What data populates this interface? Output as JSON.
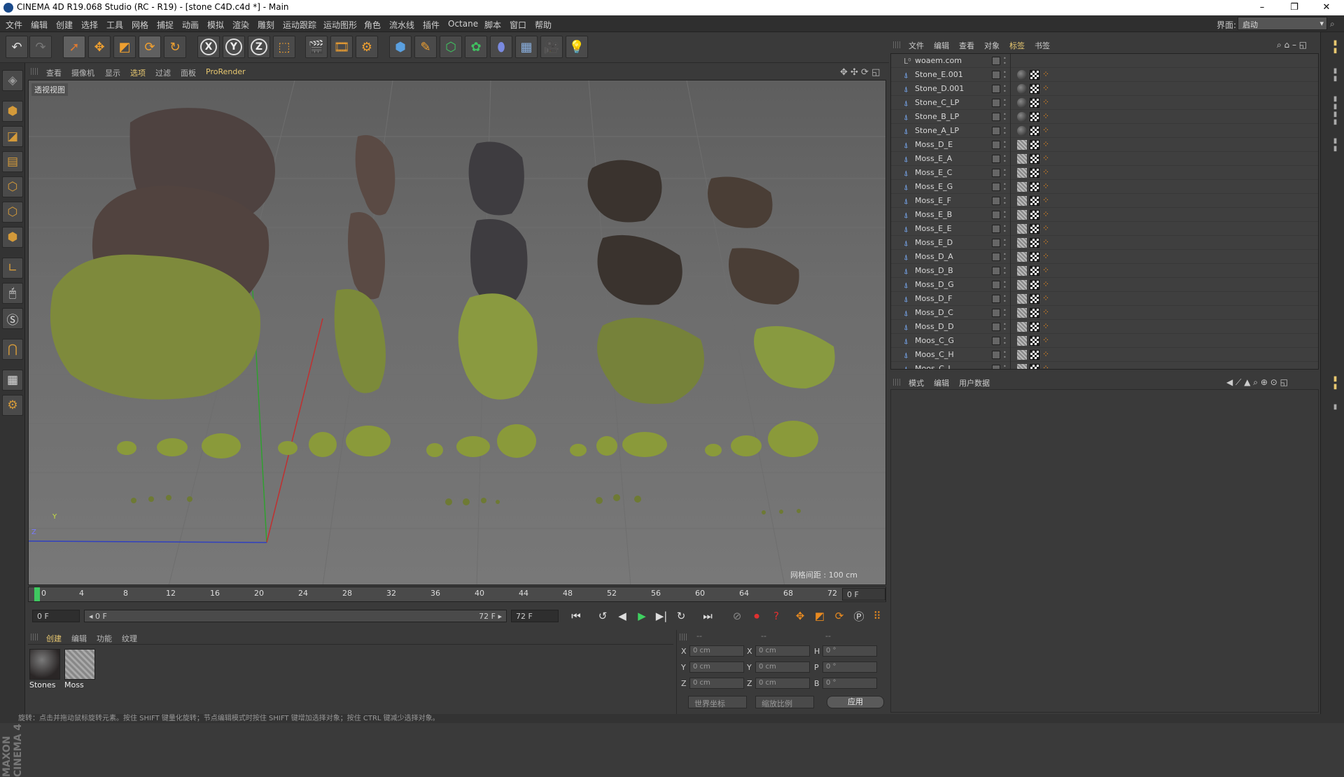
{
  "window": {
    "title": "CINEMA 4D R19.068 Studio (RC - R19) - [stone C4D.c4d *] - Main",
    "controls": [
      "–",
      "❐",
      "✕"
    ]
  },
  "menubar": {
    "items": [
      "文件",
      "编辑",
      "创建",
      "选择",
      "工具",
      "网格",
      "捕捉",
      "动画",
      "模拟",
      "渲染",
      "雕刻",
      "运动跟踪",
      "运动图形",
      "角色",
      "流水线",
      "插件",
      "Octane",
      "脚本",
      "窗口",
      "帮助"
    ],
    "layout_label": "界面:",
    "layout_value": "启动"
  },
  "viewport": {
    "menu": [
      "查看",
      "摄像机",
      "显示",
      "选项",
      "过滤",
      "面板"
    ],
    "prorender": "ProRender",
    "label": "透视视图",
    "grid_spacing": "网格间距 : 100 cm",
    "axis_x": "X",
    "axis_y": "Y",
    "axis_z": "Z"
  },
  "timeline": {
    "ticks": [
      "0",
      "4",
      "8",
      "12",
      "16",
      "20",
      "24",
      "28",
      "32",
      "36",
      "40",
      "44",
      "48",
      "52",
      "56",
      "60",
      "64",
      "68",
      "72"
    ],
    "current_frame": "0 F"
  },
  "transport": {
    "start": "0 F",
    "range_start": "◂ 0 F",
    "range_end": "72 F ▸",
    "end": "72 F"
  },
  "material_manager": {
    "menu": [
      "创建",
      "编辑",
      "功能",
      "纹理"
    ],
    "materials": [
      {
        "name": "Stones"
      },
      {
        "name": "Moss"
      }
    ]
  },
  "coordinates": {
    "headers": [
      "--",
      "--",
      "--"
    ],
    "rows": [
      {
        "a": "X",
        "av": "0 cm",
        "b": "X",
        "bv": "0 cm",
        "c": "H",
        "cv": "0 °"
      },
      {
        "a": "Y",
        "av": "0 cm",
        "b": "Y",
        "bv": "0 cm",
        "c": "P",
        "cv": "0 °"
      },
      {
        "a": "Z",
        "av": "0 cm",
        "b": "Z",
        "bv": "0 cm",
        "c": "B",
        "cv": "0 °"
      }
    ],
    "world": "世界坐标",
    "scale": "缩放比例",
    "apply": "应用"
  },
  "object_manager": {
    "menu": [
      "文件",
      "编辑",
      "查看",
      "对象",
      "标签",
      "书签"
    ],
    "active_menu": "标签",
    "root": "woaem.com",
    "objects": [
      {
        "name": "Stone_E.001",
        "mat": "stone"
      },
      {
        "name": "Stone_D.001",
        "mat": "stone"
      },
      {
        "name": "Stone_C_LP",
        "mat": "stone"
      },
      {
        "name": "Stone_B_LP",
        "mat": "stone"
      },
      {
        "name": "Stone_A_LP",
        "mat": "stone"
      },
      {
        "name": "Moss_D_E",
        "mat": "moss"
      },
      {
        "name": "Moss_E_A",
        "mat": "moss"
      },
      {
        "name": "Moss_E_C",
        "mat": "moss"
      },
      {
        "name": "Moss_E_G",
        "mat": "moss"
      },
      {
        "name": "Moss_E_F",
        "mat": "moss"
      },
      {
        "name": "Moss_E_B",
        "mat": "moss"
      },
      {
        "name": "Moss_E_E",
        "mat": "moss"
      },
      {
        "name": "Moss_E_D",
        "mat": "moss"
      },
      {
        "name": "Moss_D_A",
        "mat": "moss"
      },
      {
        "name": "Moss_D_B",
        "mat": "moss"
      },
      {
        "name": "Moss_D_G",
        "mat": "moss"
      },
      {
        "name": "Moss_D_F",
        "mat": "moss"
      },
      {
        "name": "Moss_D_C",
        "mat": "moss"
      },
      {
        "name": "Moss_D_D",
        "mat": "moss"
      },
      {
        "name": "Moos_C_G",
        "mat": "moss"
      },
      {
        "name": "Moos_C_H",
        "mat": "moss"
      },
      {
        "name": "Moos_C_I",
        "mat": "moss"
      }
    ]
  },
  "attribute_manager": {
    "menu": [
      "模式",
      "编辑",
      "用户数据"
    ]
  },
  "status": "旋转：点击并拖动鼠标旋转元素。按住 SHIFT 键量化旋转；节点编辑模式时按住 SHIFT 键增加选择对象；按住 CTRL 键减少选择对象。",
  "colors": {
    "accent": "#e8c870",
    "play": "#3fd060",
    "record": "#e03030",
    "key": "#e88a20",
    "moss": "#9aa83a",
    "stone": "#5a4a46"
  }
}
